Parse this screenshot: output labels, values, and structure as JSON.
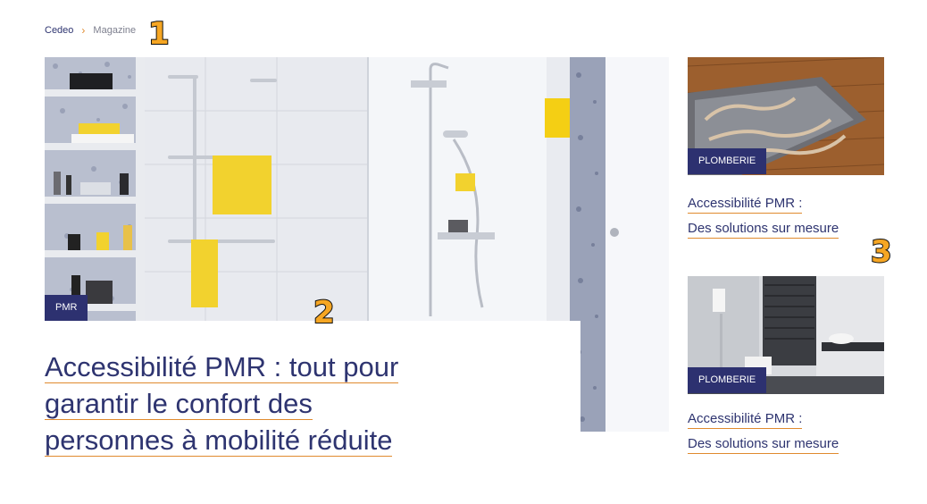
{
  "breadcrumb": {
    "home": "Cedeo",
    "separator": "›",
    "current": "Magazine"
  },
  "markers": {
    "m1": "1",
    "m2": "2",
    "m3": "3"
  },
  "hero": {
    "tag": "PMR",
    "title_lines": [
      "Accessibilité PMR : tout pour",
      "garantir le confort des",
      "personnes à mobilité réduite"
    ]
  },
  "side_articles": [
    {
      "tag": "PLOMBERIE",
      "title_lines": [
        "Accessibilité PMR :",
        "Des solutions sur mesure"
      ],
      "image": "underfloor-heating-image"
    },
    {
      "tag": "PLOMBERIE",
      "title_lines": [
        "Accessibilité PMR :",
        "Des solutions sur mesure"
      ],
      "image": "bathroom-image"
    }
  ],
  "colors": {
    "navy": "#2d3170",
    "accent": "#e08a2e",
    "marker": "#f6a623",
    "yellow": "#f2d22e"
  }
}
